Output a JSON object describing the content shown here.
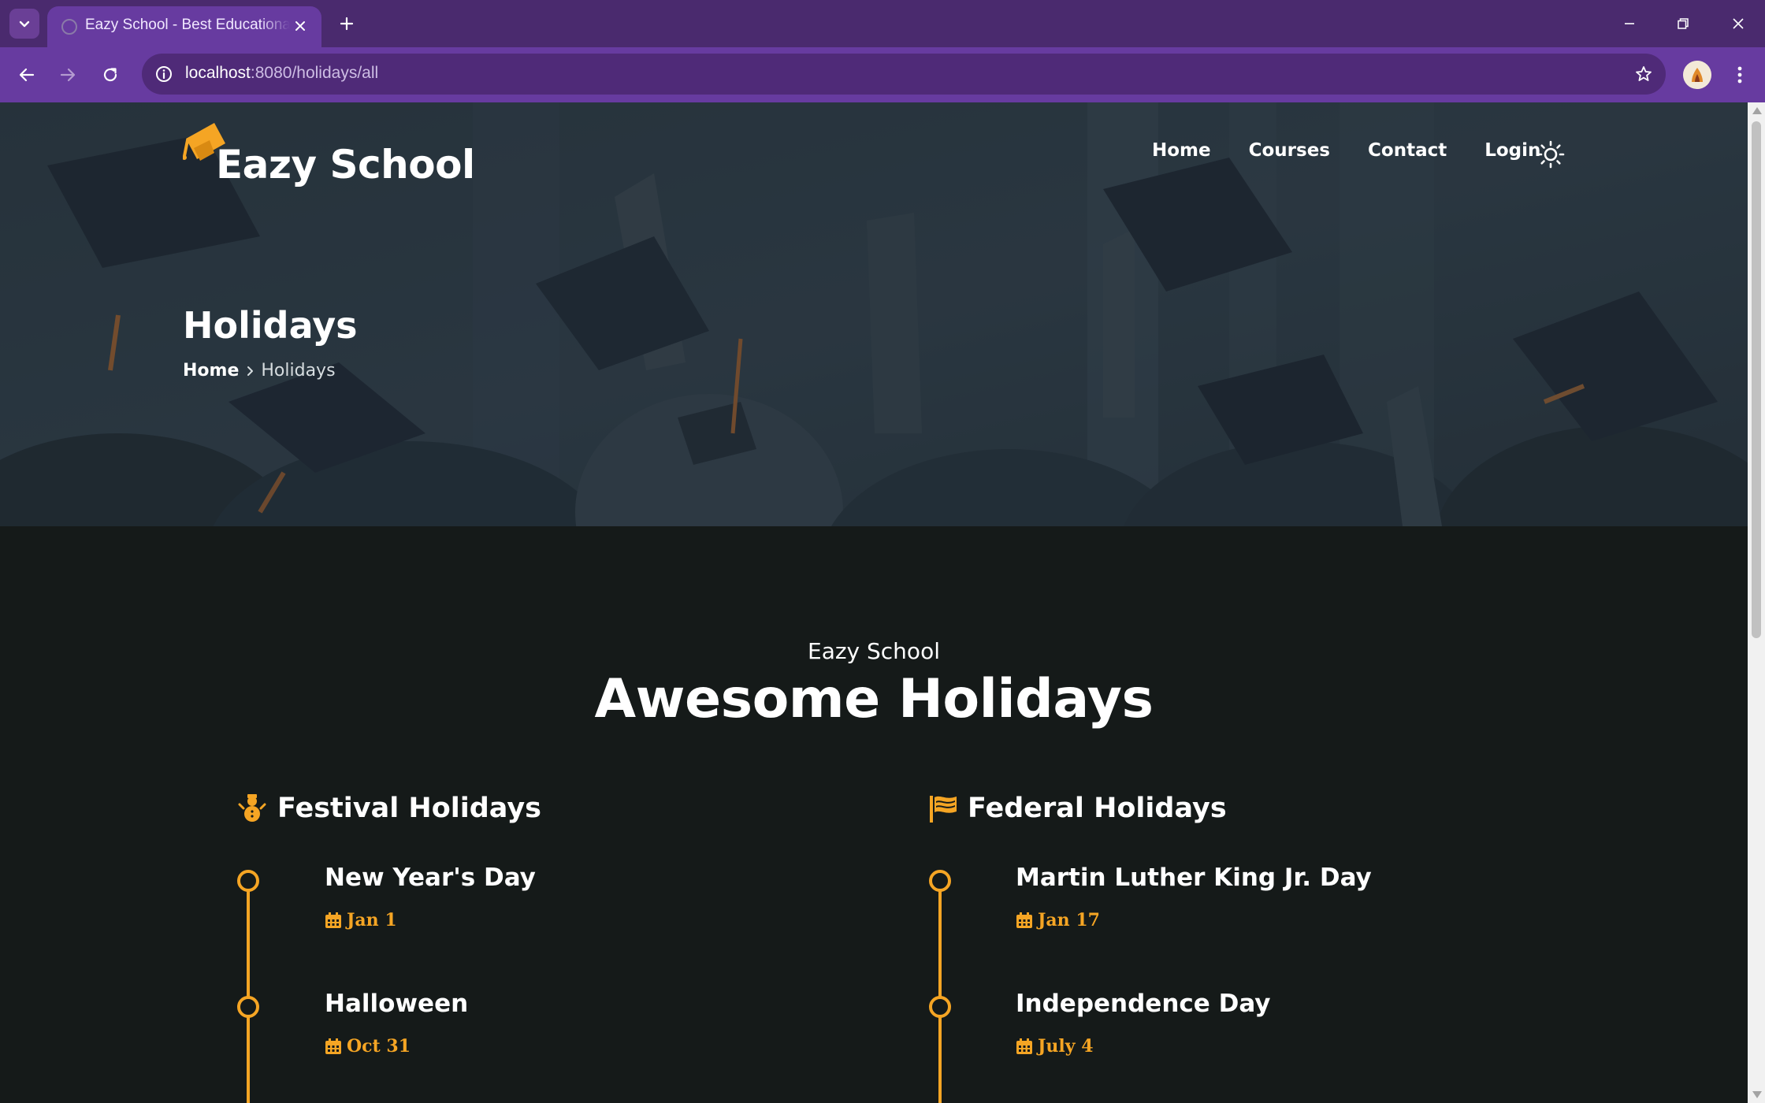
{
  "browser": {
    "tab_title": "Eazy School - Best Educational Institute",
    "url_host": "localhost",
    "url_rest": ":8080/holidays/all"
  },
  "site": {
    "logo_text": "Eazy School",
    "nav": {
      "home": "Home",
      "courses": "Courses",
      "contact": "Contact",
      "login": "Login"
    }
  },
  "hero": {
    "title": "Holidays",
    "breadcrumb": {
      "home": "Home",
      "current": "Holidays"
    }
  },
  "section": {
    "subtitle": "Eazy School",
    "title": "Awesome Holidays"
  },
  "festival": {
    "heading": "Festival Holidays",
    "items": [
      {
        "name": "New Year's Day",
        "date": "Jan 1"
      },
      {
        "name": "Halloween",
        "date": "Oct 31"
      }
    ]
  },
  "federal": {
    "heading": "Federal Holidays",
    "items": [
      {
        "name": "Martin Luther King Jr. Day",
        "date": "Jan 17"
      },
      {
        "name": "Independence Day",
        "date": "July 4"
      }
    ]
  },
  "colors": {
    "browser_frame": "#4a2a6e",
    "browser_toolbar": "#673ba0",
    "accent": "#f5a524",
    "page_bg": "#151a19"
  }
}
